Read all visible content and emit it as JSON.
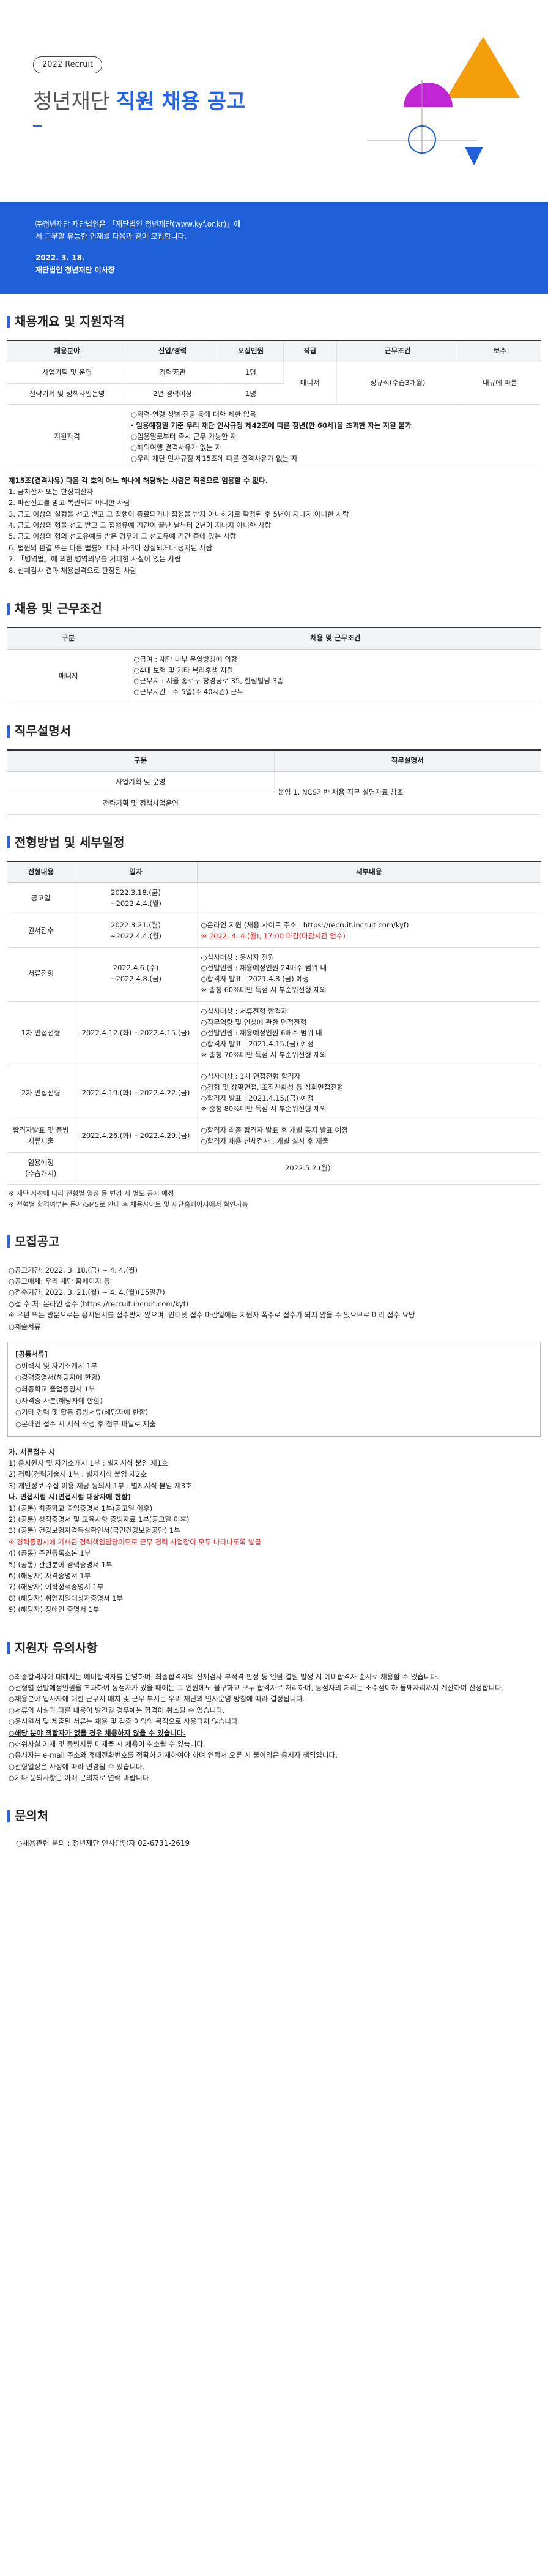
{
  "colors": {
    "accent": "#1e5fd8",
    "orange": "#f59e0b",
    "purple": "#c026d3"
  },
  "hero": {
    "badge": "2022 Recruit",
    "title_prefix": "청년재단",
    "title_highlight": "직원 채용 공고",
    "intro": "㈜청년재단 재단법인은 「재단법인 청년재단(www.kyf.or.kr)」에서 근무할 유능한 인재를 다음과 같이 모집합니다.",
    "date": "2022. 3. 18.",
    "signer": "재단법인 청년재단 이사장"
  },
  "s1": {
    "title": "채용개요 및 지원자격",
    "headers": [
      "채용분야",
      "신입/경력",
      "모집인원",
      "직급",
      "근무조건",
      "보수"
    ],
    "rows": [
      [
        "사업기획 및 운영",
        "경력无관",
        "1명"
      ],
      [
        "전략기획 및 정책사업운영",
        "2년 경력이상",
        "1명"
      ]
    ],
    "rank": "매니저",
    "cond": "정규직(수습3개월)",
    "pay": "내규에 따름",
    "qual_label": "지원자격",
    "quals": [
      "○학력·연령·성별·전공 등에 대한 제한 없음",
      "· 임용예정일 기준 우리 재단 인사규정 제42조에 따른 정년(만 60세)을 초과한 자는 지원 불가",
      "○임용일로부터 즉시 근무 가능한 자",
      "○해외여행 결격사유가 없는 자",
      "○우리 재단 인사규정 제15조에 따른 결격사유가 없는 자"
    ],
    "rule_title": "제15조(결격사유) 다음 각 호의 어느 하나에 해당하는 사람은 직원으로 임용할 수 없다.",
    "rules": [
      "1. 금치산자 또는 한정치산자",
      "2. 파산선고를 받고 복권되지 아니한 사람",
      "3. 금고 이상의 실형을 선고 받고 그 집행이 종료되거나 집행을 받지 아니하기로 확정된 후 5년이 지나지 아니한 사람",
      "4. 금고 이상의 형을 선고 받고 그 집행유예 기간이 끝난 날부터 2년이 지나지 아니한 사람",
      "5. 금고 이상의 형의 선고유예를 받은 경우에 그 선고유예 기간 중에 있는 사람",
      "6. 법원의 판결 또는 다른 법률에 따라 자격이 상실되거나 정지된 사람",
      "7. 「병역법」에 의한 병역의무를 기피한 사실이 있는 사람",
      "8. 신체검사 결과 채용실격으로 판정된 사람"
    ]
  },
  "s2": {
    "title": "채용 및 근무조건",
    "headers": [
      "구분",
      "채용 및 근무조건"
    ],
    "label": "매니저",
    "items": [
      "○급여 : 재단 내부 운영방침에 의함",
      "○4대 보험 및 기타 복리후생 지원",
      "○근무지 : 서울 종로구 창경궁로 35, 한림빌딩 3층",
      "○근무시간 : 주 5일(주 40시간) 근무"
    ]
  },
  "s3": {
    "title": "직무설명서",
    "headers": [
      "구분",
      "직무설명서"
    ],
    "rows": [
      "사업기획 및 운영",
      "전략기획 및 정책사업운영"
    ],
    "desc": "붙임 1. NCS기반 채용 직무 설명자료 참조"
  },
  "s4": {
    "title": "전형방법 및 세부일정",
    "headers": [
      "전형내용",
      "일자",
      "세부내용"
    ],
    "rows": [
      {
        "name": "공고일",
        "date": "2022.3.18.(금)\n~2022.4.4.(월)",
        "detail": []
      },
      {
        "name": "원서접수",
        "date": "2022.3.21.(월)\n~2022.4.4.(월)",
        "detail": [
          "○온라인 지원 (채용 사이트 주소 : https://recruit.incruit.com/kyf)",
          "※ 2022. 4. 4.(월), 17:00 마감(마감시간 엄수)"
        ]
      },
      {
        "name": "서류전형",
        "date": "2022.4.6.(수)\n~2022.4.8.(금)",
        "detail": [
          "○심사대상 : 응시자 전원",
          "○선발인원 : 채용예정인원 24배수 범위 내",
          "○합격자 발표 : 2021.4.8.(금) 예정",
          "※ 충청 60%미만 득점 시 부순위전형 제외"
        ]
      },
      {
        "name": "1차 면접전형",
        "date": "2022.4.12.(화) ~2022.4.15.(금)",
        "detail": [
          "○심사대상 : 서류전형 합격자",
          "○직무역량 및 인성에 관한 면접전형",
          "○선발인원 : 채용예정인원 6배수 범위 내",
          "○합격자 발표 : 2021.4.15.(금) 예정",
          "※ 충청 70%미만 득점 시 부순위전형 제외"
        ]
      },
      {
        "name": "2차 면접전형",
        "date": "2022.4.19.(화) ~2022.4.22.(금)",
        "detail": [
          "○심사대상 : 1차 면접전형 합격자",
          "○경험 및 상황면접, 조직친화성 등 심화면접전형",
          "○합격자 발표 : 2021.4.15.(금) 예정",
          "※ 충청 80%미만 득점 시 부순위전형 제외"
        ]
      },
      {
        "name": "합격자발표 및 증빙서류제출",
        "date": "2022.4.26.(화) ~2022.4.29.(금)",
        "detail": [
          "○합격자 최종 합격자 발표 후 개별 통지 발표 예정",
          "○합격자 채용 신체검사 : 개별 실시 후 제출"
        ]
      },
      {
        "name": "임용예정\n(수습개시)",
        "date": "",
        "detail": [
          "2022.5.2.(월)"
        ]
      }
    ],
    "notes": [
      "※ 재단 사정에 따라 전형별 일정 등 변경 시 별도 공지 예정",
      "※ 전형별 합격여부는 문자/SMS로 안내 후 채용사이트 및 재단홈페이지에서 확인가능"
    ]
  },
  "s5": {
    "title": "모집공고",
    "lines": [
      "○공고기간: 2022. 3. 18.(금) ~ 4. 4.(월)",
      "○공고매체: 우리 재단 홈페이지 등",
      "○접수기간: 2022. 3. 21.(월) ~ 4. 4.(월)(15일간)",
      "○접 수 처: 온라인 접수 (https://recruit.incruit.com/kyf)",
      "※ 우편 또는 방문으로는 응시원서를 접수받지 않으며, 인터넷 접수 마감일에는 지원자 폭주로 접수가 되지 않을 수 있으므로 미리 접수 요망",
      "○제출서류"
    ],
    "box_title": "[공통서류]",
    "box": [
      "○이력서 및 자기소개서 1부",
      "○경력증명서(해당자에 한함)",
      "○최종학교 졸업증명서 1부",
      "○자격증 사본(해당자에 한함)",
      "○기타 경력 및 활동 증빙서류(해당자에 한함)",
      "○온라인 접수 시 서식 작성 후 첨부 파일로 제출"
    ],
    "sub": [
      "가. 서류접수 시",
      "1) 응시원서 및 자기소개서 1부 : 별지서식 붙임 제1호",
      "2) 경력(경력기술서 1부 : 별지서식 붙임 제2호",
      "3) 개인정보 수집 이용 제공 동의서 1부 : 별지서식 붙임 제3호",
      "나. 면접시험 시(면접시험 대상자에 한함)",
      "1) (공통) 최종학교 졸업증명서 1부(공고일 이후)",
      "2) (공통) 성적증명서 및 교육사항 증빙자료 1부(공고일 이후)",
      "3) (공통) 건강보험자격득실확인서(국민건강보험공단) 1부",
      "※ 경력증명서에 기재된 경력책임담당이므로 근무 경력 사업장이 모두 나타나도록 발급",
      "4) (공통) 주민등록초본 1부",
      "5) (공통) 관련분야 경력증명서 1부",
      "6) (해당자) 자격증명서 1부",
      "7) (해당자) 어학성적증명서 1부",
      "8) (해당자) 취업지원대상자증명서 1부",
      "9) (해당자) 장애인 증명서 1부"
    ]
  },
  "s6": {
    "title": "지원자 유의사항",
    "items": [
      "○최종합격자에 대해서는 예비합격자를 운영하며, 최종합격자의 신체검사 부적격 판정 등 인원 결원 발생 시 예비합격자 순서로 채용할 수 있습니다.",
      "○전형별 선발예정인원을 초과하여 동점자가 있을 때에는 그 인원에도 불구하고 모두 합격자로 처리하며, 동점자의 처리는 소수점이하 둘째자리까지 계산하여 산정합니다.",
      "○채용분야 입사자에 대한 근무지 배치 및 근무 부서는 우리 재단의 인사운영 방침에 따라 결정됩니다.",
      "○서류의 사실과 다른 내용이 발견될 경우에는 합격이 취소될 수 있습니다.",
      "○응시원서 및 제출된 서류는 채용 및 검증 이외의 목적으로 사용되지 않습니다.",
      "○해당 분야 적합자가 없을 경우 채용하지 않을 수 있습니다.",
      "○허위사실 기재 및 증빙서류 미제출 시 채용이 취소될 수 있습니다.",
      "○응시자는 e-mail 주소와 휴대전화번호를 정확히 기재하여야 하며 연락처 오류 시 불이익은 응시자 책임입니다.",
      "○전형일정은 사정에 따라 변경될 수 있습니다.",
      "○기타 문의사항은 아래 문의처로 연락 바랍니다."
    ]
  },
  "s7": {
    "title": "문의처",
    "line": "○채용관련 문의 : 청년재단 인사담당자 02-6731-2619"
  }
}
